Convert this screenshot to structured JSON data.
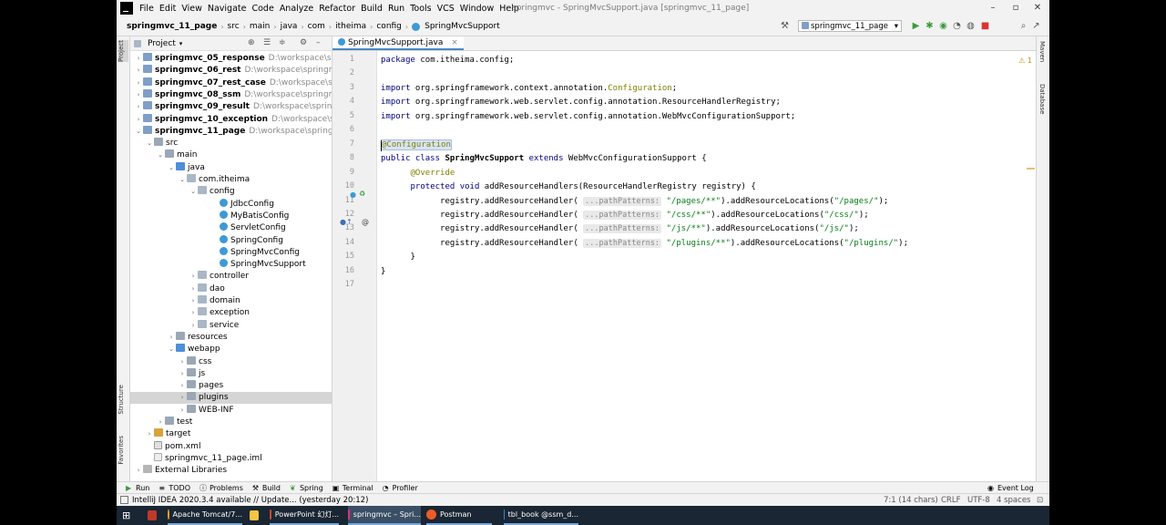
{
  "window": {
    "title": "springmvc - SpringMvcSupport.java [springmvc_11_page]",
    "minimize": "–",
    "maximize": "▫",
    "close": "✕"
  },
  "menu": [
    "File",
    "Edit",
    "View",
    "Navigate",
    "Code",
    "Analyze",
    "Refactor",
    "Build",
    "Run",
    "Tools",
    "VCS",
    "Window",
    "Help"
  ],
  "breadcrumbs": [
    "springmvc_11_page",
    "src",
    "main",
    "java",
    "com",
    "itheima",
    "config",
    "SpringMvcSupport"
  ],
  "toolbar": {
    "run_config": "springmvc_11_page"
  },
  "left_stripe": {
    "project": "Project",
    "structure": "Structure",
    "favorites": "Favorites"
  },
  "right_stripe": {
    "maven": "Maven",
    "database": "Database"
  },
  "project_panel": {
    "title": "Project",
    "rows": [
      {
        "label": "springmvc_05_response",
        "path": "D:\\workspace\\springm",
        "bold": true,
        "icon": "module",
        "arrow": "›"
      },
      {
        "label": "springmvc_06_rest",
        "path": "D:\\workspace\\springmvc\\s",
        "bold": true,
        "icon": "module",
        "arrow": "›"
      },
      {
        "label": "springmvc_07_rest_case",
        "path": "D:\\workspace\\springm",
        "bold": true,
        "icon": "module",
        "arrow": "›"
      },
      {
        "label": "springmvc_08_ssm",
        "path": "D:\\workspace\\springmvc\\s",
        "bold": true,
        "icon": "module",
        "arrow": "›"
      },
      {
        "label": "springmvc_09_result",
        "path": "D:\\workspace\\springmvc",
        "bold": true,
        "icon": "module",
        "arrow": "›"
      },
      {
        "label": "springmvc_10_exception",
        "path": "D:\\workspace\\spring",
        "bold": true,
        "icon": "module",
        "arrow": "›"
      },
      {
        "label": "springmvc_11_page",
        "path": "D:\\workspace\\springmvc\\",
        "bold": true,
        "icon": "module",
        "arrow": "⌄"
      },
      {
        "label": "src",
        "path": "",
        "bold": false,
        "icon": "folder",
        "arrow": "⌄"
      },
      {
        "label": "main",
        "path": "",
        "bold": false,
        "icon": "folder",
        "arrow": "⌄"
      },
      {
        "label": "java",
        "path": "",
        "bold": false,
        "icon": "folder-blue",
        "arrow": "⌄"
      },
      {
        "label": "com.itheima",
        "path": "",
        "bold": false,
        "icon": "pkg",
        "arrow": "⌄"
      },
      {
        "label": "config",
        "path": "",
        "bold": false,
        "icon": "pkg",
        "arrow": "⌄"
      },
      {
        "label": "JdbcConfig",
        "path": "",
        "bold": false,
        "icon": "cls",
        "arrow": ""
      },
      {
        "label": "MyBatisConfig",
        "path": "",
        "bold": false,
        "icon": "cls",
        "arrow": ""
      },
      {
        "label": "ServletConfig",
        "path": "",
        "bold": false,
        "icon": "cls",
        "arrow": ""
      },
      {
        "label": "SpringConfig",
        "path": "",
        "bold": false,
        "icon": "cls",
        "arrow": ""
      },
      {
        "label": "SpringMvcConfig",
        "path": "",
        "bold": false,
        "icon": "cls",
        "arrow": ""
      },
      {
        "label": "SpringMvcSupport",
        "path": "",
        "bold": false,
        "icon": "cls",
        "arrow": ""
      },
      {
        "label": "controller",
        "path": "",
        "bold": false,
        "icon": "pkg",
        "arrow": "›"
      },
      {
        "label": "dao",
        "path": "",
        "bold": false,
        "icon": "pkg",
        "arrow": "›"
      },
      {
        "label": "domain",
        "path": "",
        "bold": false,
        "icon": "pkg",
        "arrow": "›"
      },
      {
        "label": "exception",
        "path": "",
        "bold": false,
        "icon": "pkg",
        "arrow": "›"
      },
      {
        "label": "service",
        "path": "",
        "bold": false,
        "icon": "pkg",
        "arrow": "›"
      },
      {
        "label": "resources",
        "path": "",
        "bold": false,
        "icon": "folder",
        "arrow": "›"
      },
      {
        "label": "webapp",
        "path": "",
        "bold": false,
        "icon": "folder-blue",
        "arrow": "⌄"
      },
      {
        "label": "css",
        "path": "",
        "bold": false,
        "icon": "folder",
        "arrow": "›"
      },
      {
        "label": "js",
        "path": "",
        "bold": false,
        "icon": "folder",
        "arrow": "›"
      },
      {
        "label": "pages",
        "path": "",
        "bold": false,
        "icon": "folder",
        "arrow": "›"
      },
      {
        "label": "plugins",
        "path": "",
        "bold": false,
        "icon": "folder",
        "arrow": "›",
        "selected": true
      },
      {
        "label": "WEB-INF",
        "path": "",
        "bold": false,
        "icon": "folder",
        "arrow": "›"
      },
      {
        "label": "test",
        "path": "",
        "bold": false,
        "icon": "folder",
        "arrow": "›"
      },
      {
        "label": "target",
        "path": "",
        "bold": false,
        "icon": "folder-orange",
        "arrow": "›"
      },
      {
        "label": "pom.xml",
        "path": "",
        "bold": false,
        "icon": "file-xml",
        "arrow": ""
      },
      {
        "label": "springmvc_11_page.iml",
        "path": "",
        "bold": false,
        "icon": "file-iml",
        "arrow": ""
      },
      {
        "label": "External Libraries",
        "path": "",
        "bold": false,
        "icon": "lib",
        "arrow": "›"
      }
    ]
  },
  "editor": {
    "tab_label": "SpringMvcSupport.java",
    "tab_close": "×",
    "warning": "⚠ 1",
    "line_numbers": [
      "1",
      "2",
      "3",
      "4",
      "5",
      "6",
      "7",
      "8",
      "9",
      "10",
      "11",
      "12",
      "13",
      "14",
      "15",
      "16",
      "17"
    ],
    "lines": {
      "l1": [
        "package",
        " com.itheima.config;"
      ],
      "l3": [
        "import",
        " org.springframework.context.annotation.",
        "Configuration",
        ";"
      ],
      "l4": [
        "import",
        " org.springframework.web.servlet.config.annotation.ResourceHandlerRegistry;"
      ],
      "l5": [
        "import",
        " org.springframework.web.servlet.config.annotation.WebMvcConfigurationSupport;"
      ],
      "l7": [
        "@Configuration"
      ],
      "l8": [
        "public class ",
        "SpringMvcSupport",
        " extends",
        " WebMvcConfigurationSupport {"
      ],
      "l9": [
        "@Override"
      ],
      "l10": [
        "protected void ",
        "addResourceHandlers",
        "(ResourceHandlerRegistry registry) {"
      ],
      "l11": [
        "registry.addResourceHandler( ",
        "...pathPatterns:",
        " \"/pages/**\"",
        ").addResourceLocations(",
        "\"/pages/\"",
        ");"
      ],
      "l12": [
        "registry.addResourceHandler( ",
        "...pathPatterns:",
        " \"/css/**\"",
        ").addResourceLocations(",
        "\"/css/\"",
        ");"
      ],
      "l13": [
        "registry.addResourceHandler( ",
        "...pathPatterns:",
        " \"/js/**\"",
        ").addResourceLocations(",
        "\"/js/\"",
        ");"
      ],
      "l14": [
        "registry.addResourceHandler( ",
        "...pathPatterns:",
        " \"/plugins/**\"",
        ").addResourceLocations(",
        "\"/plugins/\"",
        ");"
      ],
      "l15": [
        "}"
      ],
      "l16": [
        "}"
      ]
    }
  },
  "tool_windows": [
    "Run",
    "TODO",
    "Problems",
    "Build",
    "Spring",
    "Terminal",
    "Profiler"
  ],
  "event_log": "Event Log",
  "status": {
    "message": "IntelliJ IDEA 2020.3.4 available // Update... (yesterday 20:12)",
    "position": "7:1 (14 chars)",
    "line_sep": "CRLF",
    "encoding": "UTF-8",
    "indent": "4 spaces"
  },
  "taskbar": [
    {
      "label": "",
      "color": "#c0392b"
    },
    {
      "label": "Apache Tomcat/7...",
      "color": "#e8a33d"
    },
    {
      "label": "",
      "color": "#f4c542"
    },
    {
      "label": "PowerPoint 幻灯...",
      "color": "#d24726"
    },
    {
      "label": "springmvc – Spri...",
      "color": "#e0327a"
    },
    {
      "label": "Postman",
      "color": "#ef5b25"
    },
    {
      "label": "tbl_book @ssm_d...",
      "color": "#3a86c8"
    }
  ]
}
